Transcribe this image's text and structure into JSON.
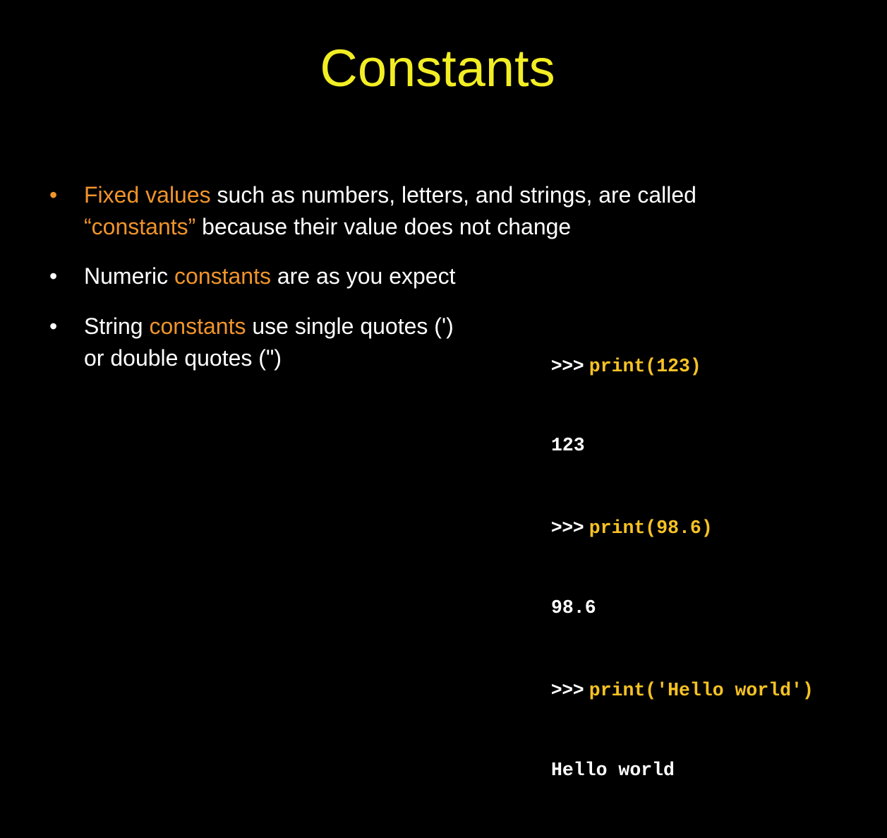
{
  "slide": {
    "title": "Constants",
    "colors": {
      "background": "#000000",
      "title": "#f2ee24",
      "highlight": "#f0942b",
      "text": "#ffffff",
      "code_command": "#f7c224"
    },
    "bullets": [
      {
        "line1_highlight": "Fixed values",
        "line1_rest": " such as numbers, letters, and strings, are called",
        "line2_highlight": "“constants”",
        "line2_rest": " because their value does not change"
      },
      {
        "before": "Numeric ",
        "highlight": "constants",
        "after": " are as you expect"
      },
      {
        "before": "String ",
        "highlight": "constants",
        "after": " use single quotes (')",
        "line2": "or double quotes (\")"
      }
    ],
    "code": [
      {
        "prompt": ">>> ",
        "command": "print(123)"
      },
      {
        "output": "123"
      },
      {
        "prompt": ">>> ",
        "command": "print(98.6)"
      },
      {
        "output": "98.6"
      },
      {
        "prompt": ">>> ",
        "command": "print('Hello world')"
      },
      {
        "output": "Hello world"
      }
    ]
  }
}
